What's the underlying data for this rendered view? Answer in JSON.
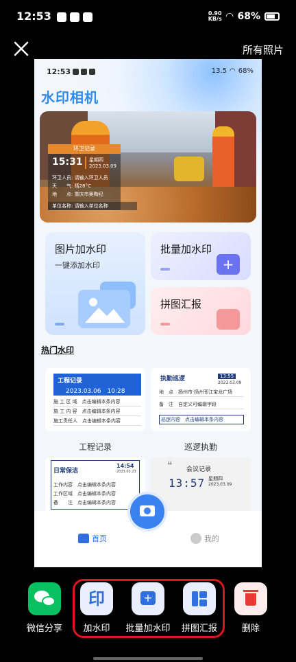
{
  "status_bar": {
    "time": "12:53",
    "speed_value": "0.90",
    "speed_unit": "KB/s",
    "battery": "68%"
  },
  "top_bar": {
    "all_photos": "所有照片"
  },
  "preview": {
    "status_time": "12:53",
    "status_speed": "13.5",
    "status_battery": "68%",
    "app_title": "水印相机",
    "watermark": {
      "title": "环卫记录",
      "time": "15:31",
      "weekday": "星期四",
      "date": "2023.03.09",
      "person": "环卫人员: 请输入环卫人员",
      "weather": "天　　气: 晴28°C",
      "location": "地　　点: 重庆市奥陶纪",
      "unit": "单位名称: 请输入单位名称"
    },
    "cards": {
      "image_watermark": "图片加水印",
      "image_watermark_sub": "一键添加水印",
      "batch_watermark": "批量加水印",
      "collage_report": "拼图汇报"
    },
    "hot_title": "热门水印",
    "templates": [
      {
        "title": "工程记录",
        "datetime": "2023.03.06　10:28",
        "rows": [
          "施 工 区 域　点击编辑本条内容",
          "施 工 内 容　点击编辑本条内容",
          "施工责任人　点击编辑本条内容"
        ],
        "label": "工程记录"
      },
      {
        "title": "执勤巡逻",
        "time": "13:55",
        "date": "2023.03.09",
        "rows": [
          "地　点　扬州市·扬州邗江宝龙广场",
          "备　注　自定义可编辑字段"
        ],
        "box": "巡逻内容　点击编辑本条内容",
        "label": "巡逻执勤"
      },
      {
        "title": "日常保洁",
        "time": "14:54",
        "date": "2023.02.23",
        "rows": [
          "工作内容　点击编辑本条内容",
          "工作区域　点击编辑本条内容",
          "备　　注　点击编辑本条内容"
        ]
      },
      {
        "title": "会议记录",
        "time": "13:57",
        "weekday": "星期四",
        "date": "2023.03.09"
      }
    ],
    "tabs": {
      "home": "首页",
      "me": "我的"
    }
  },
  "actions": [
    {
      "label": "微信分享"
    },
    {
      "label": "加水印",
      "glyph": "印"
    },
    {
      "label": "批量加水印",
      "glyph": "+"
    },
    {
      "label": "拼图汇报"
    },
    {
      "label": "删除"
    }
  ],
  "colors": {
    "accent": "#2f6fe0",
    "highlight": "#e0151f",
    "wechat": "#07c160",
    "delete": "#e53935"
  }
}
